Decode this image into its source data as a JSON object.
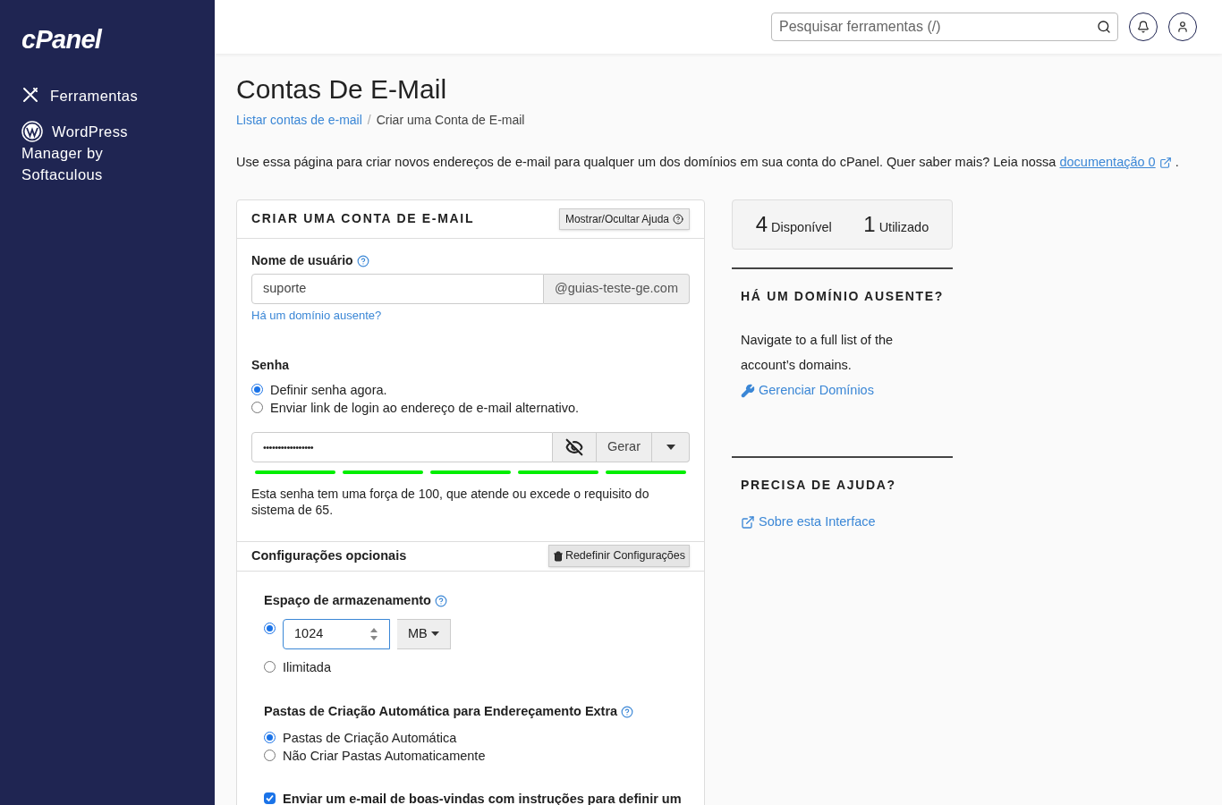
{
  "sidebar": {
    "logo": "cPanel",
    "items": [
      {
        "label": "Ferramentas"
      },
      {
        "label": "WordPress Manager by Softaculous"
      }
    ]
  },
  "header": {
    "search": {
      "placeholder": "Pesquisar ferramentas (/)"
    }
  },
  "page": {
    "title": "Contas De E-Mail",
    "breadcrumb": [
      {
        "label": "Listar contas de e-mail",
        "kind": "link"
      },
      {
        "kind": "separator",
        "label": "/"
      },
      {
        "label": "Criar uma Conta de E-mail",
        "kind": "current"
      }
    ],
    "intro": {
      "text": "Use essa página para criar novos endereços de e-mail para qualquer um dos domínios em sua conta do cPanel. Quer saber mais? Leia nossa",
      "link": "documentação 0",
      "end": "."
    }
  },
  "form": {
    "title": "CRIAR UMA CONTA DE E-MAIL",
    "help_button": "Mostrar/Ocultar Ajuda",
    "username": {
      "label": "Nome de usuário",
      "value": "suporte",
      "domain": "@guias-teste-ge.com",
      "link": "Há um domínio ausente?"
    },
    "password": {
      "label": "Senha",
      "options": [
        {
          "label": "Definir senha agora.",
          "selected": true
        },
        {
          "label": "Enviar link de login ao endereço de e-mail alternativo.",
          "selected": false
        }
      ],
      "value": "•••••••••••••••••",
      "generate": "Gerar",
      "strength_bars": [
        {
          "on": true
        },
        {
          "on": true
        },
        {
          "on": true
        },
        {
          "on": true
        },
        {
          "on": true
        }
      ],
      "message": "Esta senha tem uma força de 100, que atende ou excede o requisito do sistema de 65."
    }
  },
  "optional": {
    "title": "Configurações opcionais",
    "reset_button": "Redefinir Configurações",
    "storage": {
      "label": "Espaço de armazenamento",
      "options": [
        {
          "kind": "quota",
          "value": "1024",
          "unit": "MB",
          "selected": true
        },
        {
          "kind": "label",
          "label": "Ilimitada",
          "selected": false
        }
      ]
    },
    "folders": {
      "label": "Pastas de Criação Automática para Endereçamento Extra",
      "options": [
        {
          "label": "Pastas de Criação Automática",
          "selected": true
        },
        {
          "label": "Não Criar Pastas Automaticamente",
          "selected": false
        }
      ]
    },
    "welcome": {
      "label": "Enviar um e-mail de boas-vindas com instruções para definir um",
      "checked": true
    }
  },
  "stats": [
    {
      "value": "4",
      "label": "Disponível"
    },
    {
      "value": "1",
      "label": "Utilizado"
    }
  ],
  "missing_domain": {
    "title": "HÁ UM DOMÍNIO AUSENTE?",
    "text": "Navigate to a full list of the account’s domains.",
    "link": "Gerenciar Domínios"
  },
  "help": {
    "title": "PRECISA DE AJUDA?",
    "link": "Sobre esta Interface"
  }
}
